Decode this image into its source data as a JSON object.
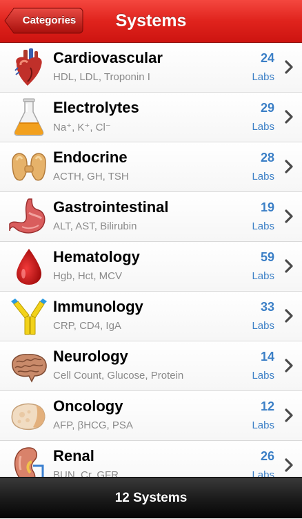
{
  "navbar": {
    "back_label": "Categories",
    "title": "Systems"
  },
  "rows": [
    {
      "name": "Cardiovascular",
      "sub": "HDL, LDL, Troponin I",
      "count": "24",
      "unit": "Labs",
      "icon": "heart-icon"
    },
    {
      "name": "Electrolytes",
      "sub": "Na⁺, K⁺, Cl⁻",
      "count": "29",
      "unit": "Labs",
      "icon": "flask-icon"
    },
    {
      "name": "Endocrine",
      "sub": "ACTH, GH, TSH",
      "count": "28",
      "unit": "Labs",
      "icon": "thyroid-icon"
    },
    {
      "name": "Gastrointestinal",
      "sub": "ALT, AST, Bilirubin",
      "count": "19",
      "unit": "Labs",
      "icon": "stomach-icon"
    },
    {
      "name": "Hematology",
      "sub": "Hgb, Hct, MCV",
      "count": "59",
      "unit": "Labs",
      "icon": "blood-drop-icon"
    },
    {
      "name": "Immunology",
      "sub": "CRP, CD4, IgA",
      "count": "33",
      "unit": "Labs",
      "icon": "antibody-icon"
    },
    {
      "name": "Neurology",
      "sub": "Cell Count, Glucose, Protein",
      "count": "14",
      "unit": "Labs",
      "icon": "brain-icon"
    },
    {
      "name": "Oncology",
      "sub": "AFP, βHCG, PSA",
      "count": "12",
      "unit": "Labs",
      "icon": "tumor-icon"
    },
    {
      "name": "Renal",
      "sub": "BUN, Cr, GFR",
      "count": "26",
      "unit": "Labs",
      "icon": "kidney-icon"
    }
  ],
  "toolbar": {
    "label": "12 Systems"
  },
  "colors": {
    "navbar_red": "#e0231d",
    "accent_blue": "#3b7fc6",
    "subtitle_gray": "#8a8a8a"
  }
}
